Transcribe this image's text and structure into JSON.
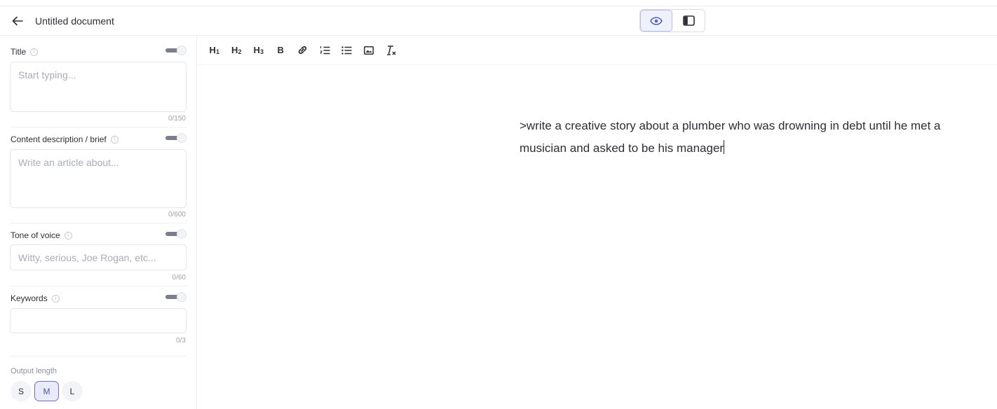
{
  "header": {
    "title": "Untitled document",
    "views": [
      {
        "icon": "eye-icon",
        "active": true
      },
      {
        "icon": "sidebar-panel-icon",
        "active": false
      }
    ]
  },
  "sidebar": {
    "title": {
      "label": "Title",
      "placeholder": "Start typing...",
      "counter": "0/150"
    },
    "brief": {
      "label": "Content description / brief",
      "placeholder": "Write an article about...",
      "counter": "0/600"
    },
    "tone": {
      "label": "Tone of voice",
      "placeholder": "Witty, serious, Joe Rogan, etc...",
      "counter": "0/60"
    },
    "keywords": {
      "label": "Keywords",
      "placeholder": "",
      "counter": "0/3"
    },
    "output": {
      "label": "Output length",
      "sizes": [
        "S",
        "M",
        "L"
      ],
      "selected": "M"
    }
  },
  "toolbar": {
    "h1": "H",
    "h1_sub": "1",
    "h2": "H",
    "h2_sub": "2",
    "h3": "H",
    "h3_sub": "3",
    "bold": "B"
  },
  "editor": {
    "text": ">write a creative story about a plumber who was drowning in debt until he met a musician and asked to be his manager"
  },
  "colors": {
    "accent": "#6b70c9",
    "accent_bg": "#e9ebfa"
  }
}
